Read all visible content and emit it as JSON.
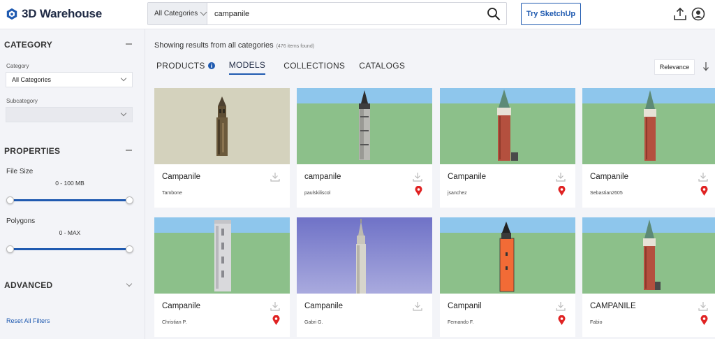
{
  "header": {
    "logo_text": "3D Warehouse",
    "search_category": "All Categories",
    "search_value": "campanile",
    "try_button": "Try SketchUp",
    "icons": [
      "search-icon",
      "upload-icon",
      "user-icon"
    ]
  },
  "sidebar": {
    "category_heading": "CATEGORY",
    "category_label": "Category",
    "category_value": "All Categories",
    "subcategory_label": "Subcategory",
    "subcategory_value": "",
    "properties_heading": "PROPERTIES",
    "file_size_label": "File Size",
    "file_size_range": "0 - 100 MB",
    "file_size_slider": {
      "min": 0,
      "max": 1
    },
    "polygons_label": "Polygons",
    "polygons_range": "0 - MAX",
    "polygons_slider": {
      "min": 0,
      "max": 1
    },
    "advanced_heading": "ADVANCED",
    "reset_link": "Reset All Filters"
  },
  "main": {
    "results_text": "Showing results from all categories",
    "results_count": "(476 items found)",
    "tabs": [
      "PRODUCTS",
      "MODELS",
      "COLLECTIONS",
      "CATALOGS"
    ],
    "active_tab": "MODELS",
    "sort_label": "Relevance",
    "accent_color": "#1f5ab0",
    "pin_color": "#e02323",
    "cards": [
      {
        "title": "Campanile",
        "author": "Tambone",
        "pin": false
      },
      {
        "title": "campanile",
        "author": "paulskiliscol",
        "pin": true
      },
      {
        "title": "Campanile",
        "author": "jsanchez",
        "pin": true
      },
      {
        "title": "Campanile",
        "author": "Sebastian2605",
        "pin": true
      },
      {
        "title": "Campanile",
        "author": "Christian P.",
        "pin": true
      },
      {
        "title": "Campanile",
        "author": "Gabri G.",
        "pin": false
      },
      {
        "title": "Campanil",
        "author": "Fernando F.",
        "pin": true
      },
      {
        "title": "CAMPANILE",
        "author": "Fabio",
        "pin": true
      }
    ]
  }
}
